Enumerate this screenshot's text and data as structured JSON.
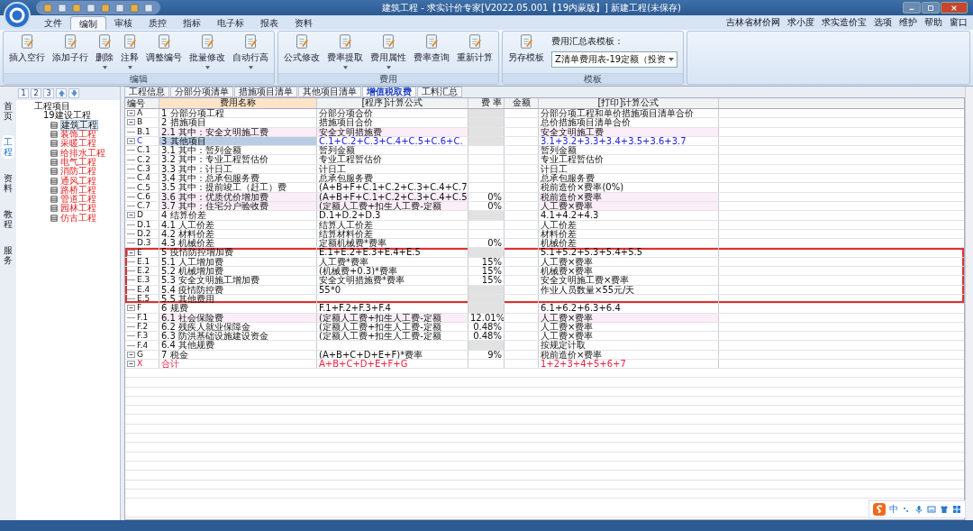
{
  "window": {
    "title": "建筑工程 - 求实计价专家[V2022.05.001【19内蒙版】] 新建工程(未保存)"
  },
  "menu_tabs": [
    {
      "label": "文件",
      "selected": false
    },
    {
      "label": "编制",
      "selected": true
    },
    {
      "label": "审核",
      "selected": false
    },
    {
      "label": "质控",
      "selected": false
    },
    {
      "label": "指标",
      "selected": false
    },
    {
      "label": "电子标",
      "selected": false
    },
    {
      "label": "报表",
      "selected": false
    },
    {
      "label": "资料",
      "selected": false
    }
  ],
  "top_links": [
    "吉林省材价网",
    "求小度",
    "求实造价宝",
    "选项",
    "维护",
    "帮助",
    "窗口"
  ],
  "ribbon": [
    {
      "title": "编辑",
      "buttons": [
        {
          "label": "插入空行",
          "dropdown": false
        },
        {
          "label": "添加子行",
          "dropdown": false
        },
        {
          "label": "删除",
          "dropdown": true
        },
        {
          "label": "注释",
          "dropdown": true
        },
        {
          "label": "调整编号",
          "dropdown": false
        },
        {
          "label": "批量修改",
          "dropdown": true
        },
        {
          "label": "自动行高",
          "dropdown": true
        }
      ]
    },
    {
      "title": "费用",
      "buttons": [
        {
          "label": "公式修改",
          "dropdown": false
        },
        {
          "label": "费率提取",
          "dropdown": true
        },
        {
          "label": "费用属性",
          "dropdown": true
        },
        {
          "label": "费率查询",
          "dropdown": false
        },
        {
          "label": "重新计算",
          "dropdown": false
        }
      ]
    },
    {
      "title": "模板",
      "buttons": [
        {
          "label": "另存模板",
          "dropdown": false
        }
      ],
      "template_label": "费用汇总表模板：",
      "template_value": "Z清单费用表-19定额（投资"
    }
  ],
  "side_tabs": [
    {
      "label": "首页",
      "selected": false
    },
    {
      "label": "工程",
      "selected": true
    },
    {
      "label": "资料",
      "selected": false
    },
    {
      "label": "教程",
      "selected": false
    },
    {
      "label": "服务",
      "selected": false
    }
  ],
  "tree_toolbar": [
    "1",
    "2",
    "3"
  ],
  "tree": [
    {
      "label": "工程项目",
      "children": [
        {
          "label": "19建设工程",
          "children": [
            {
              "label": "建筑工程",
              "selected": true
            },
            {
              "label": "装饰工程",
              "selected": false
            },
            {
              "label": "采暖工程",
              "selected": false
            },
            {
              "label": "给排水工程",
              "selected": false
            },
            {
              "label": "电气工程",
              "selected": false
            },
            {
              "label": "消防工程",
              "selected": false
            },
            {
              "label": "通风工程",
              "selected": false
            },
            {
              "label": "路桥工程",
              "selected": false
            },
            {
              "label": "管道工程",
              "selected": false
            },
            {
              "label": "园林工程",
              "selected": false
            },
            {
              "label": "仿古工程",
              "selected": false
            }
          ]
        }
      ]
    }
  ],
  "table_tabs": [
    {
      "label": "工程信息",
      "selected": false
    },
    {
      "label": "分部分项清单",
      "selected": false
    },
    {
      "label": "措施项目清单",
      "selected": false
    },
    {
      "label": "其他项目清单",
      "selected": false
    },
    {
      "label": "增值税取费",
      "selected": true
    },
    {
      "label": "工料汇总",
      "selected": false
    }
  ],
  "table": {
    "columns": [
      "编号",
      "费用名称",
      "[程序]计算公式",
      "费 率",
      "金额",
      "[打印]计算公式"
    ],
    "rows": [
      {
        "code": "A",
        "name": "1 分部分项工程",
        "formula": "分部分项合价",
        "rate": "",
        "print": "分部分项工程和单价措施项目清单合价",
        "kind": "group",
        "rate_locked": true,
        "boxed": false
      },
      {
        "code": "B",
        "name": "2 措施项目",
        "formula": "措施项目合价",
        "rate": "",
        "print": "总价措施项目清单合价",
        "kind": "group",
        "rate_locked": true,
        "boxed": false
      },
      {
        "code": "B.1",
        "name": "2.1 其中：安全文明施工费",
        "formula": "安全文明措施费",
        "rate": "",
        "print": "安全文明施工费",
        "kind": "pink",
        "rate_locked": true,
        "boxed": false
      },
      {
        "code": "C",
        "name": "3 其他项目",
        "formula": "C.1+C.2+C.3+C.4+C.5+C.6+C.",
        "rate": "",
        "print": "3.1+3.2+3.3+3.4+3.5+3.6+3.7",
        "kind": "selected",
        "rate_locked": true,
        "boxed": false
      },
      {
        "code": "C.1",
        "name": "3.1 其中：暂列金额",
        "formula": "暂列金额",
        "rate": "",
        "print": "暂列金额",
        "kind": "item",
        "rate_locked": false,
        "boxed": false
      },
      {
        "code": "C.2",
        "name": "3.2 其中：专业工程暂估价",
        "formula": "专业工程暂估价",
        "rate": "",
        "print": "专业工程暂估价",
        "kind": "item",
        "rate_locked": false,
        "boxed": false
      },
      {
        "code": "C.3",
        "name": "3.3 其中：计日工",
        "formula": "计日工",
        "rate": "",
        "print": "计日工",
        "kind": "item",
        "rate_locked": false,
        "boxed": false
      },
      {
        "code": "C.4",
        "name": "3.4 其中：总承包服务费",
        "formula": "总承包服务费",
        "rate": "",
        "print": "总承包服务费",
        "kind": "item",
        "rate_locked": false,
        "boxed": false
      },
      {
        "code": "C.5",
        "name": "3.5 其中：提前竣工（赶工）费",
        "formula": "(A+B+F+C.1+C.2+C.3+C.4+C.7",
        "rate": "",
        "print": "税前造价×费率(0%)",
        "kind": "item",
        "rate_locked": false,
        "boxed": false
      },
      {
        "code": "C.6",
        "name": "3.6 其中：优质优价增加费",
        "formula": "(A+B+F+C.1+C.2+C.3+C.4+C.5",
        "rate": "0%",
        "print": "税前造价×费率",
        "kind": "pink",
        "rate_locked": false,
        "boxed": false
      },
      {
        "code": "C.7",
        "name": "3.7 其中：住宅分户验收费",
        "formula": "(定额人工费+扣生人工费-定额",
        "rate": "0%",
        "print": "人工费×费率",
        "kind": "pink",
        "rate_locked": false,
        "boxed": false
      },
      {
        "code": "D",
        "name": "4 结算价差",
        "formula": "D.1+D.2+D.3",
        "rate": "",
        "print": "4.1+4.2+4.3",
        "kind": "group",
        "rate_locked": true,
        "boxed": false
      },
      {
        "code": "D.1",
        "name": "4.1 人工价差",
        "formula": "结算人工价差",
        "rate": "",
        "print": "人工价差",
        "kind": "item",
        "rate_locked": false,
        "boxed": false
      },
      {
        "code": "D.2",
        "name": "4.2 材料价差",
        "formula": "结算材料价差",
        "rate": "",
        "print": "材料价差",
        "kind": "item",
        "rate_locked": false,
        "boxed": false
      },
      {
        "code": "D.3",
        "name": "4.3 机械价差",
        "formula": "定额机械费*费率",
        "rate": "0%",
        "print": "机械价差",
        "kind": "item",
        "rate_locked": false,
        "boxed": false
      },
      {
        "code": "E",
        "name": "5 疫情防控增加费",
        "formula": "E.1+E.2+E.3+E.4+E.5",
        "rate": "",
        "print": "5.1+5.2+5.3+5.4+5.5",
        "kind": "group",
        "rate_locked": true,
        "boxed": true
      },
      {
        "code": "E.1",
        "name": "5.1 人工增加费",
        "formula": "人工费*费率",
        "rate": "15%",
        "print": "人工费×费率",
        "kind": "item",
        "rate_locked": false,
        "boxed": true
      },
      {
        "code": "E.2",
        "name": "5.2 机械增加费",
        "formula": "(机械费+0.3)*费率",
        "rate": "15%",
        "print": "机械费×费率",
        "kind": "item",
        "rate_locked": false,
        "boxed": true
      },
      {
        "code": "E.3",
        "name": "5.3 安全文明施工增加费",
        "formula": "安全文明措施费*费率",
        "rate": "15%",
        "print": "安全文明施工费×费率",
        "kind": "item",
        "rate_locked": false,
        "boxed": true
      },
      {
        "code": "E.4",
        "name": "5.4 疫情防控费",
        "formula": "55*0",
        "rate": "",
        "print": "作业人员数量×55元/天",
        "kind": "item",
        "rate_locked": true,
        "boxed": true
      },
      {
        "code": "E.5",
        "name": "5.5 其他费用",
        "formula": "",
        "rate": "",
        "print": "",
        "kind": "item",
        "rate_locked": true,
        "boxed": true
      },
      {
        "code": "F",
        "name": "6 规费",
        "formula": "F.1+F.2+F.3+F.4",
        "rate": "",
        "print": "6.1+6.2+6.3+6.4",
        "kind": "group",
        "rate_locked": true,
        "boxed": false
      },
      {
        "code": "F.1",
        "name": "6.1 社会保险费",
        "formula": "(定额人工费+扣生人工费-定额",
        "rate": "12.01%",
        "print": "人工费×费率",
        "kind": "pink",
        "rate_locked": false,
        "boxed": false
      },
      {
        "code": "F.2",
        "name": "6.2 残疾人就业保障金",
        "formula": "(定额人工费+扣生人工费-定额",
        "rate": "0.48%",
        "print": "人工费×费率",
        "kind": "item",
        "rate_locked": false,
        "boxed": false
      },
      {
        "code": "F.3",
        "name": "6.3 防洪基础设施建设资金",
        "formula": "(定额人工费+扣生人工费-定额",
        "rate": "0.48%",
        "print": "人工费×费率",
        "kind": "item",
        "rate_locked": false,
        "boxed": false
      },
      {
        "code": "F.4",
        "name": "6.4 其他规费",
        "formula": "",
        "rate": "",
        "print": "按规定计取",
        "kind": "item",
        "rate_locked": true,
        "boxed": false
      },
      {
        "code": "G",
        "name": "7 税金",
        "formula": "(A+B+C+D+E+F)*费率",
        "rate": "9%",
        "print": "税前造价×费率",
        "kind": "group",
        "rate_locked": false,
        "boxed": false
      },
      {
        "code": "X",
        "name": "合计",
        "formula": "A+B+C+D+E+F+G",
        "rate": "",
        "print": "1+2+3+4+5+6+7",
        "kind": "total",
        "rate_locked": false,
        "boxed": false
      }
    ]
  },
  "ime": {
    "lang": "中"
  }
}
